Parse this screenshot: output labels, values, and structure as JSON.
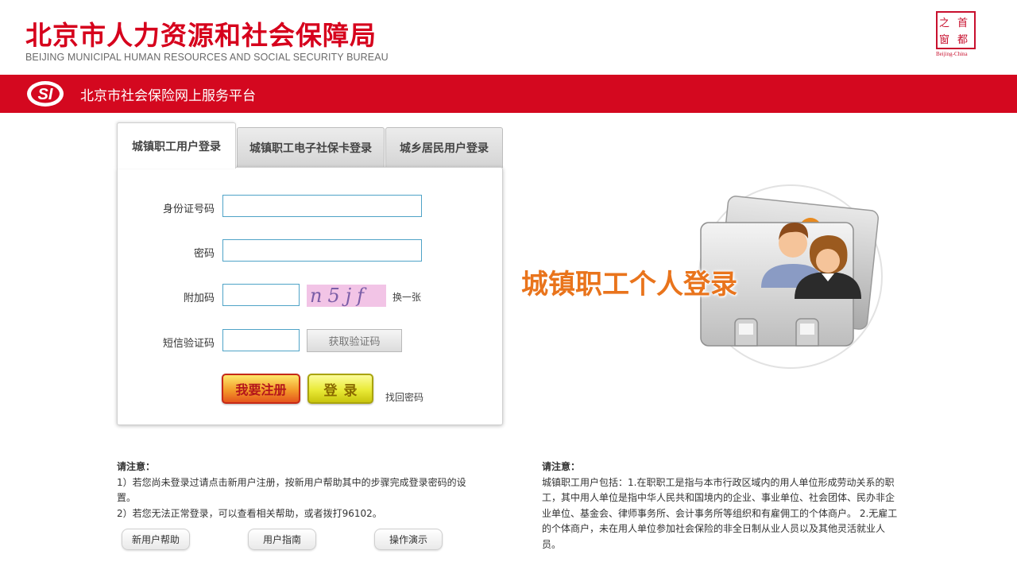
{
  "header": {
    "title": "北京市人力资源和社会保障局",
    "subtitle": "BEIJING MUNICIPAL HUMAN RESOURCES AND SOCIAL SECURITY BUREAU",
    "capital_logo": {
      "chars": [
        "之",
        "首",
        "窗",
        "都"
      ],
      "caption": "Beijing-China"
    }
  },
  "red_bar": {
    "platform_title": "北京市社会保险网上服务平台",
    "color": "#d4081f"
  },
  "tabs": [
    {
      "label": "城镇职工用户登录",
      "active": true
    },
    {
      "label": "城镇职工电子社保卡登录",
      "active": false
    },
    {
      "label": "城乡居民用户登录",
      "active": false
    }
  ],
  "form": {
    "id_label": "身份证号码",
    "id_value": "",
    "password_label": "密码",
    "password_value": "",
    "captcha_label": "附加码",
    "captcha_value": "",
    "captcha_text": "n5jf",
    "refresh_captcha": "换一张",
    "sms_label": "短信验证码",
    "sms_value": "",
    "get_code_button": "获取验证码",
    "register_button": "我要注册",
    "login_button": "登录",
    "forgot_password": "找回密码"
  },
  "illustration": {
    "caption": "城镇职工个人登录",
    "icon": "user-cards-icon"
  },
  "notes_left": {
    "title": "请注意：",
    "line1a": "1）若您尚未登录过请点击新用户注册，按新用户帮助其中的步骤完成登录密码的设",
    "line1b": "置。",
    "line2": "2）若您无法正常登录，可以查看相关帮助，或者拨打96102。"
  },
  "help_buttons": [
    "新用户帮助",
    "用户指南",
    "操作演示"
  ],
  "notes_right": {
    "title": "请注意：",
    "lines": [
      "城镇职工用户包括：1.在职职工是指与本市行政区域内的用人单位形成劳动关系的职",
      "工，其中用人单位是指中华人民共和国境内的企业、事业单位、社会团体、民办非企",
      "业单位、基金会、律师事务所、会计事务所等组织和有雇佣工的个体商户。 2.无雇工",
      "的个体商户，未在用人单位参加社会保险的非全日制从业人员以及其他灵活就业人",
      "员。"
    ]
  }
}
